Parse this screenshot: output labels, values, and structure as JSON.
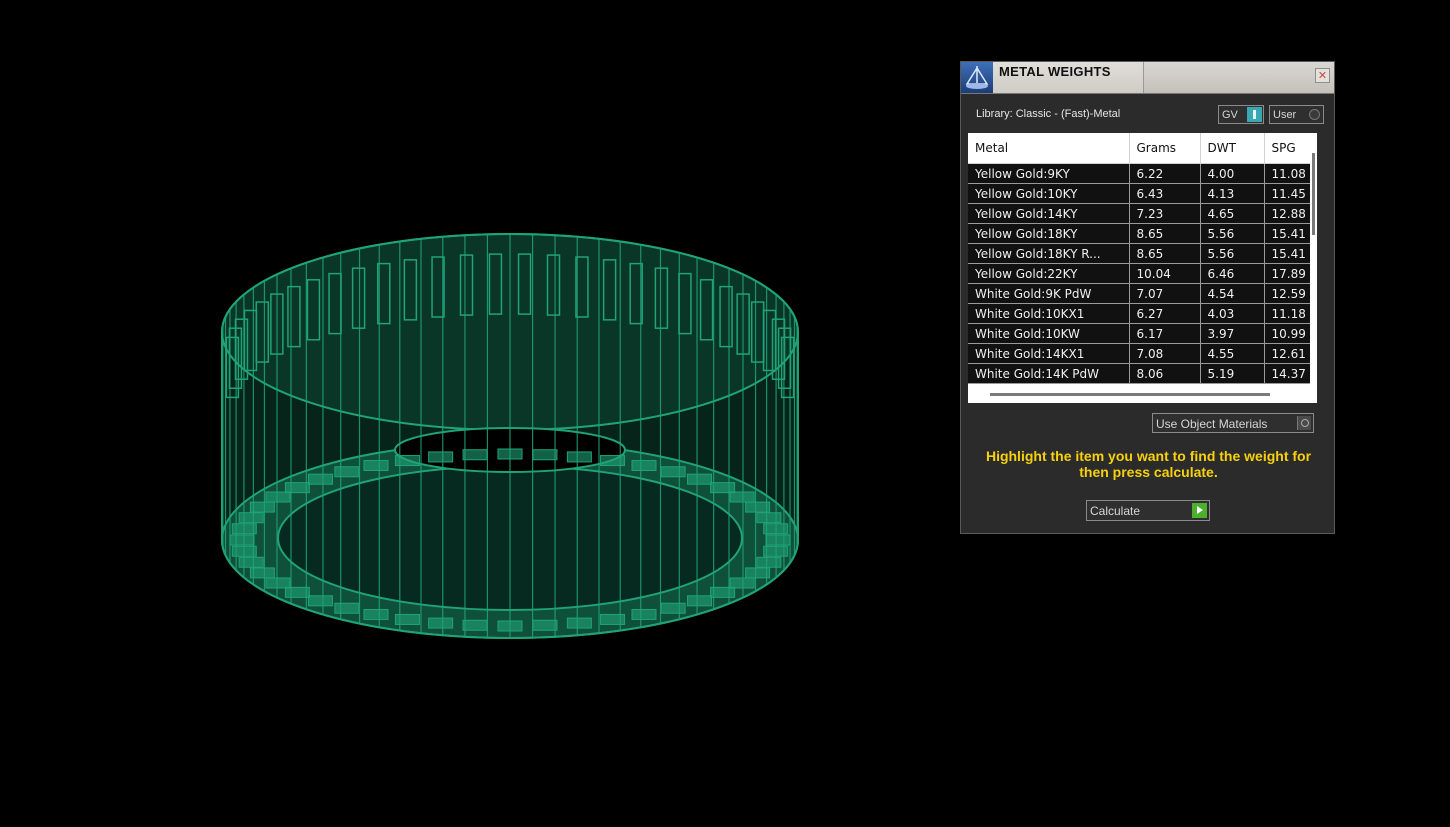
{
  "panel": {
    "title": "METAL WEIGHTS",
    "close_label": "✕",
    "library_label": "Library: Classic - (Fast)-Metal",
    "toggle_gv_label": "GV",
    "toggle_user_label": "User",
    "columns": [
      "Metal",
      "Grams",
      "DWT",
      "SPG"
    ],
    "rows": [
      [
        "Yellow Gold:9KY",
        "6.22",
        "4.00",
        "11.08"
      ],
      [
        "Yellow Gold:10KY",
        "6.43",
        "4.13",
        "11.45"
      ],
      [
        "Yellow Gold:14KY",
        "7.23",
        "4.65",
        "12.88"
      ],
      [
        "Yellow Gold:18KY",
        "8.65",
        "5.56",
        "15.41"
      ],
      [
        "Yellow Gold:18KY R...",
        "8.65",
        "5.56",
        "15.41"
      ],
      [
        "Yellow Gold:22KY",
        "10.04",
        "6.46",
        "17.89"
      ],
      [
        "White Gold:9K PdW",
        "7.07",
        "4.54",
        "12.59"
      ],
      [
        "White Gold:10KX1",
        "6.27",
        "4.03",
        "11.18"
      ],
      [
        "White Gold:10KW",
        "6.17",
        "3.97",
        "10.99"
      ],
      [
        "White Gold:14KX1",
        "7.08",
        "4.55",
        "12.61"
      ],
      [
        "White Gold:14K PdW",
        "8.06",
        "5.19",
        "14.37"
      ]
    ],
    "material_select": "Use Object Materials",
    "hint": "Highlight the item you want to find the weight for then press calculate.",
    "calculate_label": "Calculate"
  },
  "viewport": {
    "model": "ring wireframe",
    "wire_color": "#1fa377"
  },
  "colors": {
    "hint": "#f6d10c",
    "toggle_on": "#3aa7b5",
    "calculate_go": "#4db02c"
  }
}
